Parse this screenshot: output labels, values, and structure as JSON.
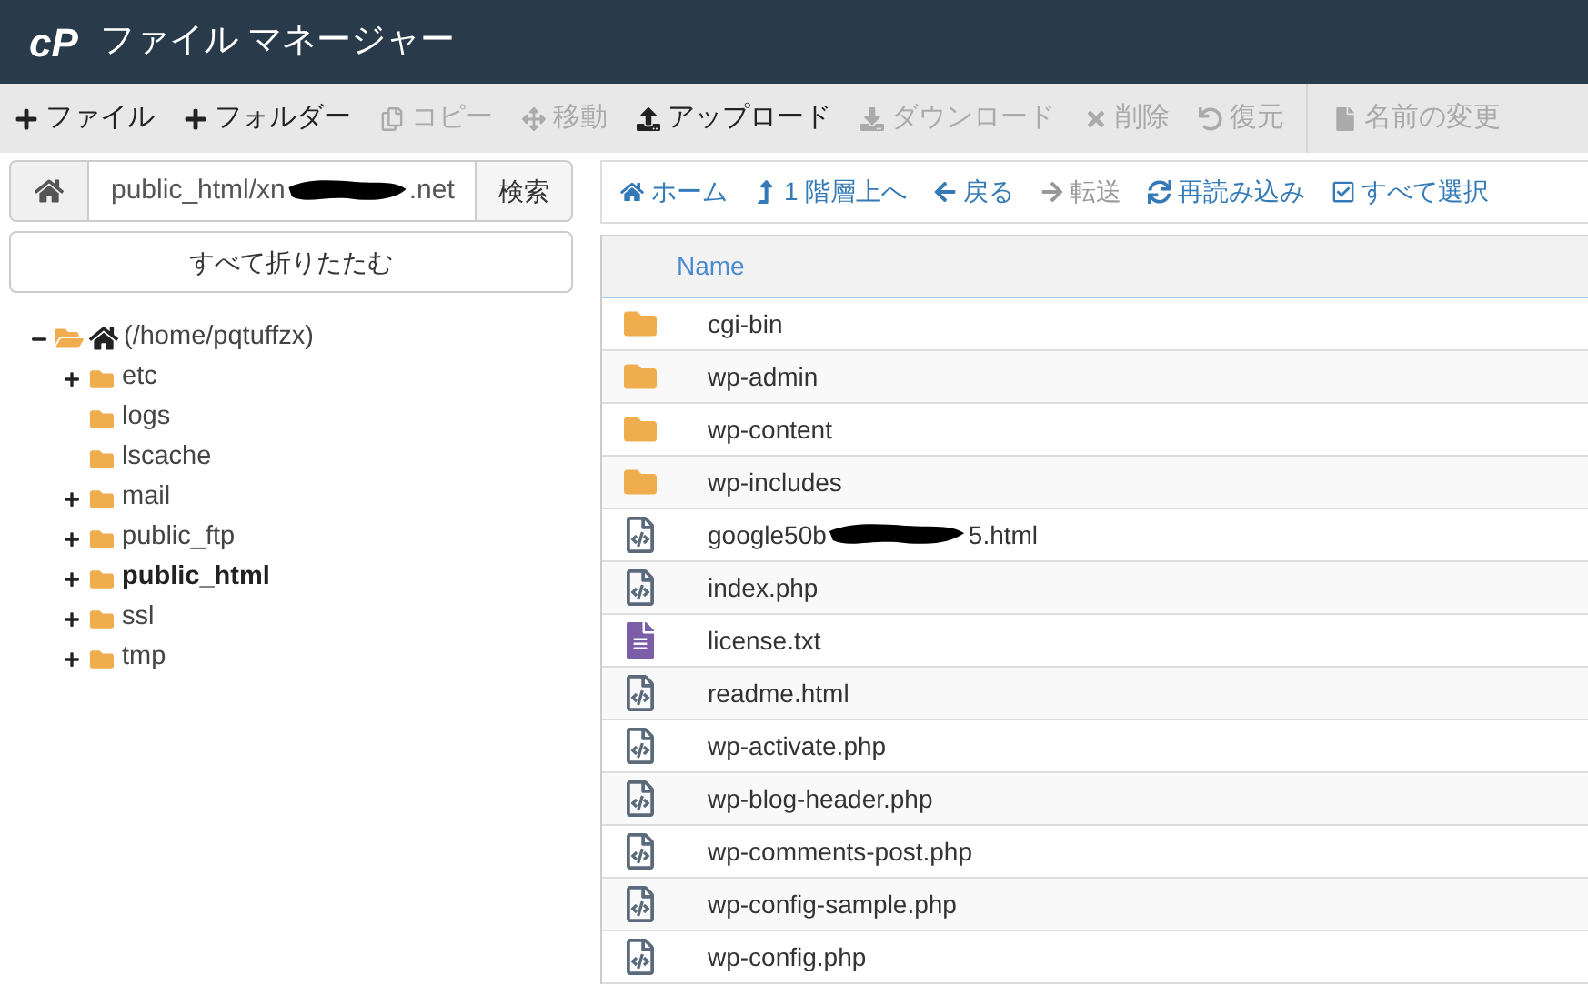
{
  "header": {
    "logo": "cP",
    "title": "ファイル マネージャー"
  },
  "toolbar": [
    {
      "kind": "plus",
      "label": "ファイル",
      "disabled": false
    },
    {
      "kind": "plus",
      "label": "フォルダー",
      "disabled": false
    },
    {
      "kind": "copy",
      "label": "コピー",
      "disabled": true
    },
    {
      "kind": "move",
      "label": "移動",
      "disabled": true
    },
    {
      "kind": "upload",
      "label": "アップロード",
      "disabled": false
    },
    {
      "kind": "download",
      "label": "ダウンロード",
      "disabled": true
    },
    {
      "kind": "delete",
      "label": "削除",
      "disabled": true
    },
    {
      "kind": "restore",
      "label": "復元",
      "disabled": true
    },
    {
      "kind": "rename",
      "label": "名前の変更",
      "disabled": true
    }
  ],
  "path_bar": {
    "path_start": "public_html/xn",
    "path_end": ".net",
    "search_button": "検索"
  },
  "collapse_button": "すべて折りたたむ",
  "tree": {
    "label": "(/home/pqtuffzx)",
    "expanded": true,
    "children": [
      {
        "label": "etc",
        "has_children": true,
        "selected": false
      },
      {
        "label": "logs",
        "has_children": false,
        "selected": false
      },
      {
        "label": "lscache",
        "has_children": false,
        "selected": false
      },
      {
        "label": "mail",
        "has_children": true,
        "selected": false
      },
      {
        "label": "public_ftp",
        "has_children": true,
        "selected": false
      },
      {
        "label": "public_html",
        "has_children": true,
        "selected": true
      },
      {
        "label": "ssl",
        "has_children": true,
        "selected": false
      },
      {
        "label": "tmp",
        "has_children": true,
        "selected": false
      }
    ]
  },
  "nav": [
    {
      "kind": "home",
      "label": "ホーム",
      "disabled": false
    },
    {
      "kind": "up",
      "label": "1 階層上へ",
      "disabled": false
    },
    {
      "kind": "back",
      "label": "戻る",
      "disabled": false
    },
    {
      "kind": "forward",
      "label": "転送",
      "disabled": true
    },
    {
      "kind": "reload",
      "label": "再読み込み",
      "disabled": false
    },
    {
      "kind": "select_all",
      "label": "すべて選択",
      "disabled": false
    }
  ],
  "table": {
    "columns": [
      "Name"
    ],
    "rows": [
      {
        "kind": "folder",
        "name": "cgi-bin"
      },
      {
        "kind": "folder",
        "name": "wp-admin"
      },
      {
        "kind": "folder",
        "name": "wp-content"
      },
      {
        "kind": "folder",
        "name": "wp-includes"
      },
      {
        "kind": "code",
        "name": "google50b",
        "name_end": "5.html"
      },
      {
        "kind": "code",
        "name": "index.php"
      },
      {
        "kind": "text",
        "name": "license.txt"
      },
      {
        "kind": "code",
        "name": "readme.html"
      },
      {
        "kind": "code",
        "name": "wp-activate.php"
      },
      {
        "kind": "code",
        "name": "wp-blog-header.php"
      },
      {
        "kind": "code",
        "name": "wp-comments-post.php"
      },
      {
        "kind": "code",
        "name": "wp-config-sample.php"
      },
      {
        "kind": "code",
        "name": "wp-config.php"
      }
    ]
  }
}
